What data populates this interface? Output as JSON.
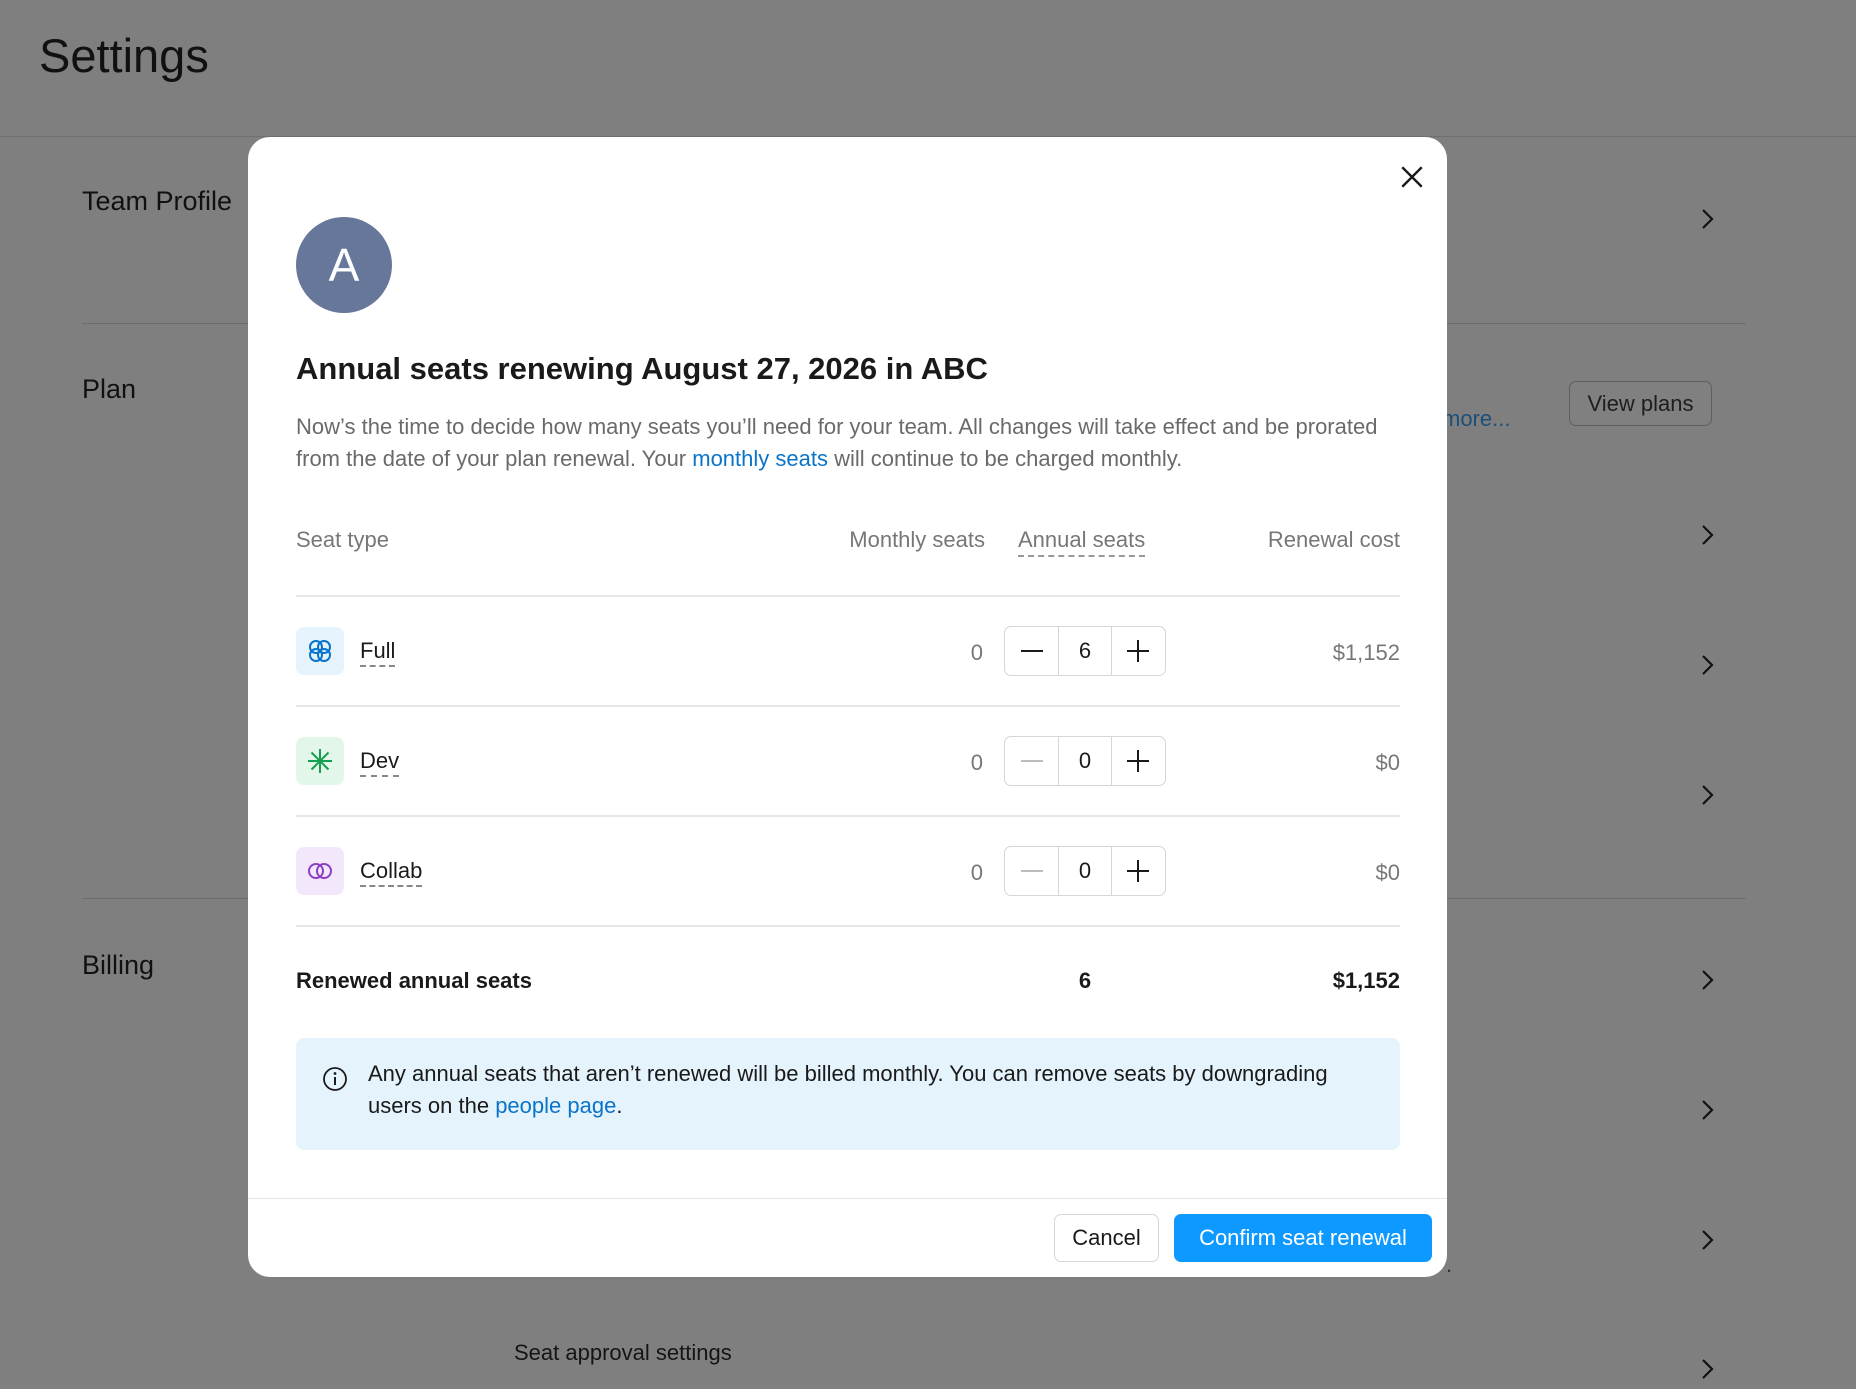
{
  "page": {
    "title": "Settings",
    "sections": [
      {
        "title": "Team Profile"
      },
      {
        "title": "Plan"
      },
      {
        "title": "Billing"
      }
    ],
    "plan_link": "more...",
    "view_plans_button": "View plans",
    "seat_approval_title": "Seat approval settings",
    "trailing_dot": "."
  },
  "modal": {
    "avatar_letter": "A",
    "title": "Annual seats renewing August 27, 2026 in ABC",
    "description_part1": "Now’s the time to decide how many seats you’ll need for your team. All changes will take effect and be prorated from the date of your plan renewal. Your ",
    "description_link": "monthly seats",
    "description_part2": " will continue to be charged monthly.",
    "columns": {
      "seat_type": "Seat type",
      "monthly": "Monthly seats",
      "annual": "Annual seats",
      "renewal_cost": "Renewal cost"
    },
    "rows": [
      {
        "name": "Full",
        "icon": "full-seat-icon",
        "monthly": "0",
        "annual": "6",
        "cost": "$1,152",
        "icon_bg": "#e5f3fd",
        "icon_color": "#0a74c9"
      },
      {
        "name": "Dev",
        "icon": "dev-seat-icon",
        "monthly": "0",
        "annual": "0",
        "cost": "$0",
        "icon_bg": "#e3f6ea",
        "icon_color": "#14a050"
      },
      {
        "name": "Collab",
        "icon": "collab-seat-icon",
        "monthly": "0",
        "annual": "0",
        "cost": "$0",
        "icon_bg": "#f3e8fb",
        "icon_color": "#8a3fc4"
      }
    ],
    "total": {
      "label": "Renewed annual seats",
      "seats": "6",
      "cost": "$1,152"
    },
    "banner": {
      "text_part1": "Any annual seats that aren’t renewed will be billed monthly. You can remove seats by downgrading users on the ",
      "link": "people page",
      "text_part2": "."
    },
    "cancel_button": "Cancel",
    "confirm_button": "Confirm seat renewal"
  },
  "colors": {
    "accent": "#0d99ff",
    "link": "#0a74c9",
    "overlay": "#808080",
    "avatar": "#667799"
  }
}
